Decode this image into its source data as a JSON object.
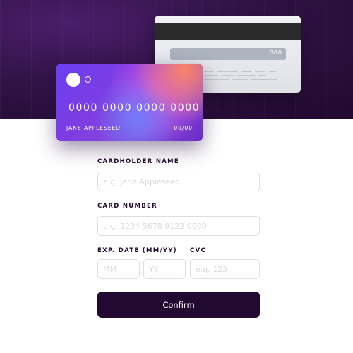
{
  "colors": {
    "hero_dark": "#21092f",
    "hero_purple": "#4a1e6b",
    "button": "#21092f",
    "card_gradient_start": "#6a3ef0",
    "card_gradient_end": "#8a4ad6"
  },
  "card_front": {
    "number": "0000 0000 0000 0000",
    "holder": "JANE APPLESEED",
    "expiry": "00/00"
  },
  "card_back": {
    "cvc": "000"
  },
  "form": {
    "cardholder_label": "CARDHOLDER NAME",
    "cardholder_placeholder": "e.g. Jane Appleseed",
    "card_number_label": "CARD NUMBER",
    "card_number_placeholder": "e.g. 1234 5678 9123 0000",
    "exp_label": "EXP. DATE (MM/YY)",
    "mm_placeholder": "MM",
    "yy_placeholder": "YY",
    "cvc_label": "CVC",
    "cvc_placeholder": "e.g. 123",
    "confirm_label": "Confirm"
  }
}
